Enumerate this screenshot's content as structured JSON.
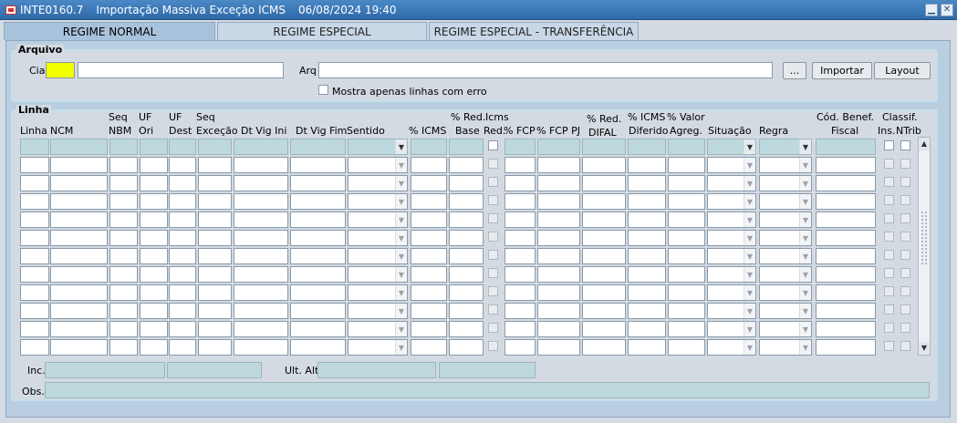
{
  "window": {
    "code": "INTE0160.7",
    "title": "Importação Massiva Exceção ICMS",
    "datetime": "06/08/2024 19:40",
    "minimize_glyph": "▁",
    "close_glyph": "✕"
  },
  "tabs": [
    {
      "label": "REGIME NORMAL",
      "active": true
    },
    {
      "label": "REGIME ESPECIAL",
      "active": false
    },
    {
      "label": "REGIME ESPECIAL - TRANSFERÊNCIA",
      "active": false
    }
  ],
  "arquivo": {
    "title": "Arquivo",
    "cia_label": "Cia",
    "arq_label": "Arq",
    "browse_label": "...",
    "importar_label": "Importar",
    "layout_label": "Layout",
    "only_errors_label": "Mostra apenas linhas com erro"
  },
  "linha": {
    "title": "Linha",
    "headers": {
      "linha": "Linha",
      "ncm": "NCM",
      "seq_nbm_1": "Seq",
      "seq_nbm_2": "NBM",
      "uf_ori_1": "UF",
      "uf_ori_2": "Ori",
      "uf_dest_1": "UF",
      "uf_dest_2": "Dest",
      "seq_exc_1": "Seq",
      "seq_exc_2": "Exceção",
      "dt_vig_ini": "Dt Vig Ini",
      "dt_vig_fim": "Dt Vig Fim",
      "sentido": "Sentido",
      "icms": "% ICMS",
      "red_base_1": "% Red.",
      "red_base_2": "Base",
      "icms_red_1": "Icms",
      "icms_red_2": "Red.",
      "fcp": "% FCP",
      "fcp_pj": "% FCP PJ",
      "red_difal_1": "% Red.",
      "red_difal_2": "DIFAL",
      "icms_dif_1": "% ICMS",
      "icms_dif_2": "Diferido",
      "valor_agreg_1": "% Valor",
      "valor_agreg_2": "Agreg.",
      "situacao": "Situação",
      "regra": "Regra",
      "cod_benef_1": "Cód. Benef.",
      "cod_benef_2": "Fiscal",
      "classif": "Classif.",
      "ins": "Ins.",
      "ntrib": "NTrib"
    },
    "row_count": 12
  },
  "footer": {
    "inc_label": "Inc.",
    "ult_alt_label": "Ult. Alt.",
    "obs_label": "Obs."
  },
  "icons": {
    "dropdown": "chevron-down-icon",
    "scroll_up": "scroll-up-arrow-icon",
    "scroll_down": "scroll-down-arrow-icon"
  },
  "colors": {
    "titlebar": "#3a78b8",
    "active_tab": "#a9c2dc",
    "panel": "#b9cfe1",
    "group_bg": "#d3dae1",
    "required_field": "#f2ff00",
    "readonly_field": "#bdd9dd"
  }
}
